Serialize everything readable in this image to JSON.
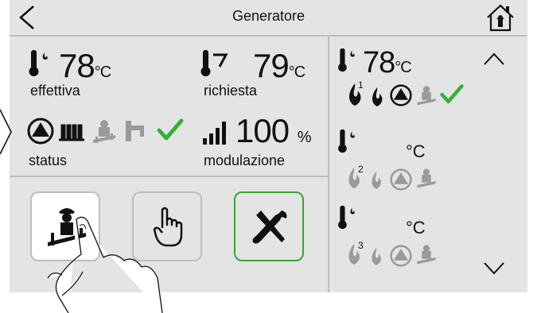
{
  "header": {
    "title": "Generatore"
  },
  "main": {
    "actual_temp": {
      "value": "78",
      "unit": "°C",
      "label": "effettiva"
    },
    "requested_temp": {
      "value": "79",
      "unit": "°C",
      "label": "richiesta"
    },
    "status": {
      "label": "status",
      "icons": [
        "pump-icon",
        "heater-icon",
        "chimney-sweep-icon",
        "tap-icon",
        "check-icon"
      ]
    },
    "modulation": {
      "value": "100",
      "unit": "%",
      "label": "modulazione"
    }
  },
  "side_list": [
    {
      "temp": "78",
      "unit": "°C",
      "index": "1",
      "active": true
    },
    {
      "temp": "",
      "unit": "°C",
      "index": "2",
      "active": false
    },
    {
      "temp": "",
      "unit": "°C",
      "index": "3",
      "active": false
    }
  ],
  "colors": {
    "panel": "#e4e4e4",
    "accent_green": "#35b035",
    "divider": "#bdbdbd",
    "inactive": "#9a9a9a"
  }
}
